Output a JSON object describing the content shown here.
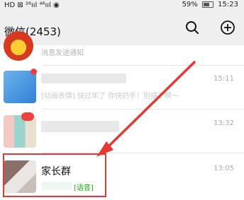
{
  "status_bar": {
    "left_icons_text": "HD ⊠ ²⁶ııl ⁴⁶ııl ◉",
    "battery": "59%",
    "time": "15:23"
  },
  "header": {
    "title": "微信(2453)",
    "search_icon": "search-icon",
    "add_icon": "plus-circle-icon"
  },
  "chats": [
    {
      "preview": "消息发送通知",
      "time": ""
    },
    {
      "preview": "[动画表情] 快过年了 你快扔手！别搞了啊～",
      "time": "15:11"
    },
    {
      "preview": "",
      "time": "13:32"
    },
    {
      "name": "家长群",
      "preview": "[语音]",
      "time": "13:05"
    }
  ],
  "colors": {
    "highlight_box": "#e53935",
    "arrow": "#e53935",
    "voice_tag": "#1aad19"
  }
}
